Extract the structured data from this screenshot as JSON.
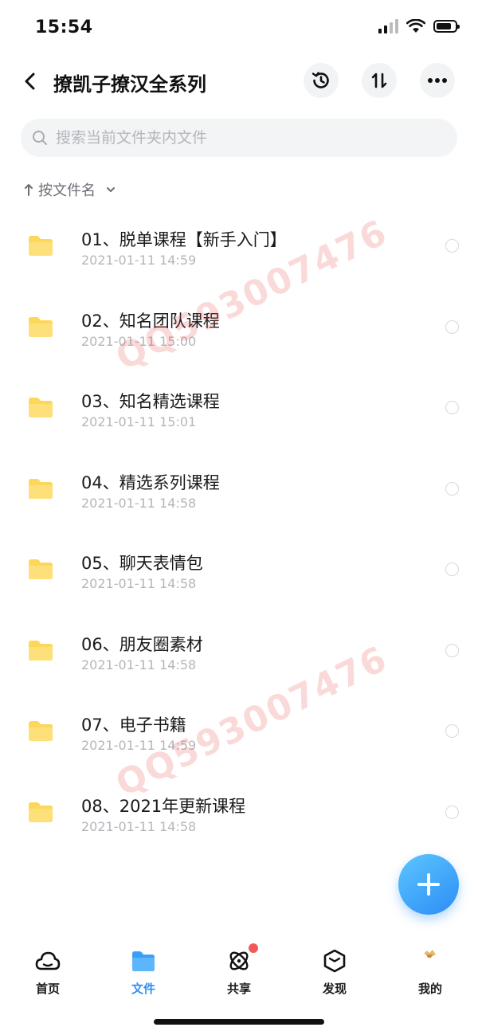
{
  "status_bar": {
    "time": "15:54",
    "battery_level": 0.8
  },
  "header": {
    "title": "撩凯子撩汉全系列",
    "back_icon": "chevron-left-icon",
    "buttons": [
      "history-icon",
      "sort-icon",
      "more-icon"
    ]
  },
  "search": {
    "placeholder": "搜索当前文件夹内文件"
  },
  "sort": {
    "label": "按文件名"
  },
  "files": [
    {
      "name": "01、脱单课程【新手入门】",
      "date": "2021-01-11 14:59"
    },
    {
      "name": "02、知名团队课程",
      "date": "2021-01-11 15:00"
    },
    {
      "name": "03、知名精选课程",
      "date": "2021-01-11 15:01"
    },
    {
      "name": "04、精选系列课程",
      "date": "2021-01-11 14:58"
    },
    {
      "name": "05、聊天表情包",
      "date": "2021-01-11 14:58"
    },
    {
      "name": "06、朋友圈素材",
      "date": "2021-01-11 14:58"
    },
    {
      "name": "07、电子书籍",
      "date": "2021-01-11 14:59"
    },
    {
      "name": "08、2021年更新课程",
      "date": "2021-01-11 14:58"
    }
  ],
  "watermark": "QQ593007476",
  "tabs": [
    {
      "label": "首页",
      "icon": "cloud-icon",
      "active": false
    },
    {
      "label": "文件",
      "icon": "folder-icon",
      "active": true
    },
    {
      "label": "共享",
      "icon": "orbit-icon",
      "active": false,
      "badge": true
    },
    {
      "label": "发现",
      "icon": "cube-icon",
      "active": false
    },
    {
      "label": "我的",
      "icon": "avatar-icon",
      "active": false
    }
  ],
  "colors": {
    "accent": "#2f8ff5",
    "folder": "#fcd75a",
    "badge": "#f25a5a",
    "watermark": "#e65050"
  }
}
